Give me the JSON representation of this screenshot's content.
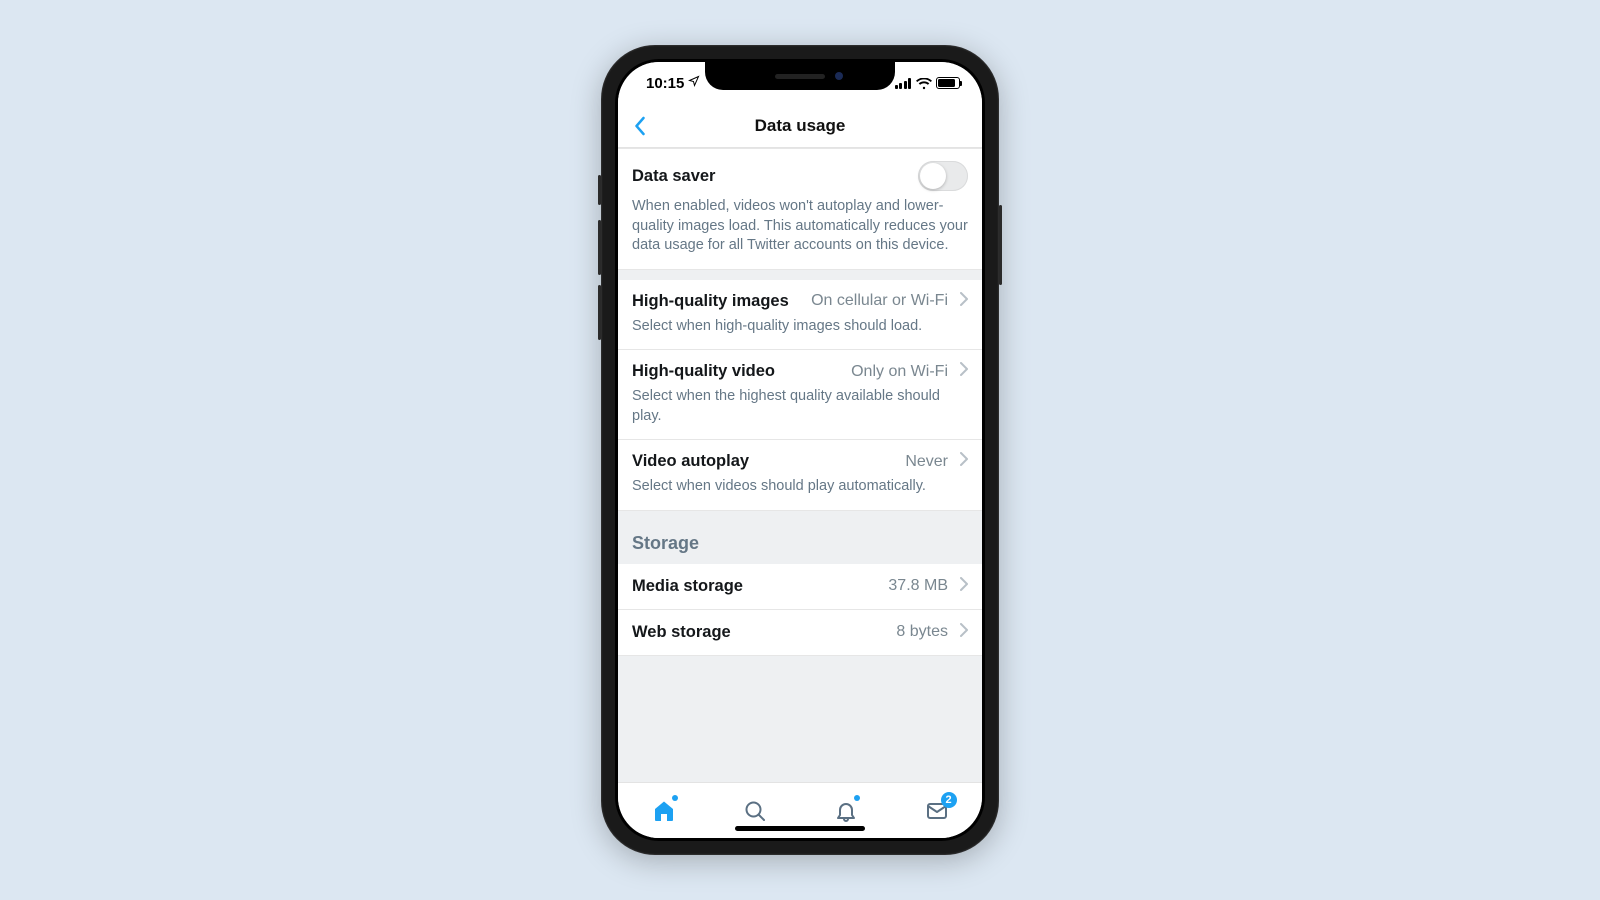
{
  "status": {
    "time": "10:15"
  },
  "header": {
    "title": "Data usage"
  },
  "data_saver": {
    "title": "Data saver",
    "enabled": false,
    "description": "When enabled, videos won't autoplay and lower-quality images load. This automatically reduces your data usage for all Twitter accounts on this device."
  },
  "quality": [
    {
      "title": "High-quality images",
      "value": "On cellular or Wi-Fi",
      "sub": "Select when high-quality images should load."
    },
    {
      "title": "High-quality video",
      "value": "Only on Wi-Fi",
      "sub": "Select when the highest quality available should play."
    },
    {
      "title": "Video autoplay",
      "value": "Never",
      "sub": "Select when videos should play automatically."
    }
  ],
  "storage": {
    "header": "Storage",
    "items": [
      {
        "title": "Media storage",
        "value": "37.8 MB"
      },
      {
        "title": "Web storage",
        "value": "8 bytes"
      }
    ]
  },
  "tabbar": {
    "messages_badge": "2"
  }
}
